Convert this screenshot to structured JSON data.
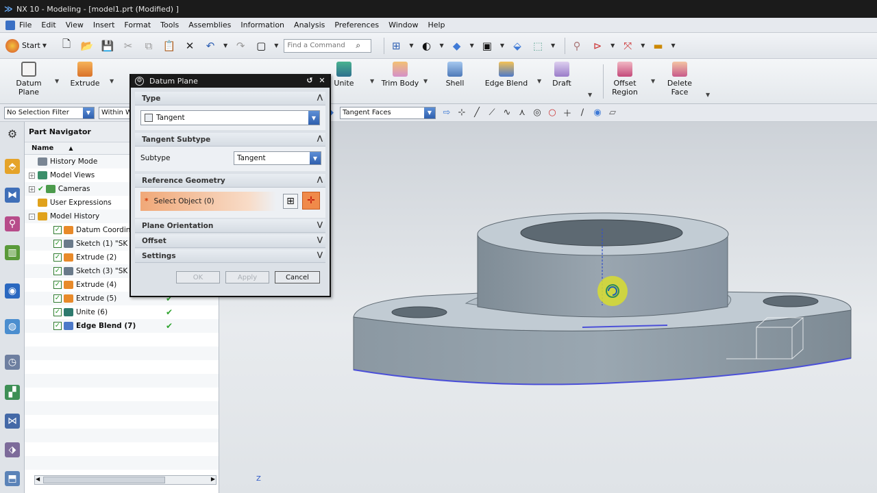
{
  "window": {
    "title": "NX 10 - Modeling - [model1.prt (Modified) ]"
  },
  "menu": [
    "File",
    "Edit",
    "View",
    "Insert",
    "Format",
    "Tools",
    "Assemblies",
    "Information",
    "Analysis",
    "Preferences",
    "Window",
    "Help"
  ],
  "toolbar": {
    "start_label": "Start",
    "search_placeholder": "Find a Command"
  },
  "ribbon": {
    "items": [
      {
        "label": "Datum Plane"
      },
      {
        "label": "Extrude"
      },
      {
        "label": "Unite"
      },
      {
        "label": "Trim Body"
      },
      {
        "label": "Shell"
      },
      {
        "label": "Edge Blend"
      },
      {
        "label": "Draft"
      },
      {
        "label": "Offset Region"
      },
      {
        "label": "Delete Face"
      }
    ]
  },
  "selection_bar": {
    "filter": "No Selection Filter",
    "scope": "Within W",
    "face_rule": "Tangent Faces"
  },
  "navigator": {
    "title": "Part Navigator",
    "column_name": "Name",
    "rows": [
      {
        "label": "History Mode",
        "level": 1,
        "expander": "",
        "check": false,
        "tick": false,
        "bold": false
      },
      {
        "label": "Model Views",
        "level": 1,
        "expander": "+",
        "check": false,
        "tick": false,
        "bold": false
      },
      {
        "label": "Cameras",
        "level": 1,
        "expander": "+",
        "check": false,
        "tick": false,
        "bold": false
      },
      {
        "label": "User Expressions",
        "level": 1,
        "expander": "",
        "check": false,
        "tick": false,
        "bold": false
      },
      {
        "label": "Model History",
        "level": 1,
        "expander": "-",
        "check": false,
        "tick": false,
        "bold": false
      },
      {
        "label": "Datum Coordin",
        "level": 2,
        "expander": "",
        "check": true,
        "tick": false,
        "bold": false
      },
      {
        "label": "Sketch (1) \"SK",
        "level": 2,
        "expander": "",
        "check": true,
        "tick": false,
        "bold": false
      },
      {
        "label": "Extrude (2)",
        "level": 2,
        "expander": "",
        "check": true,
        "tick": false,
        "bold": false
      },
      {
        "label": "Sketch (3) \"SK",
        "level": 2,
        "expander": "",
        "check": true,
        "tick": false,
        "bold": false
      },
      {
        "label": "Extrude (4)",
        "level": 2,
        "expander": "",
        "check": true,
        "tick": false,
        "bold": false
      },
      {
        "label": "Extrude (5)",
        "level": 2,
        "expander": "",
        "check": true,
        "tick": true,
        "bold": false
      },
      {
        "label": "Unite (6)",
        "level": 2,
        "expander": "",
        "check": true,
        "tick": true,
        "bold": false
      },
      {
        "label": "Edge Blend (7)",
        "level": 2,
        "expander": "",
        "check": true,
        "tick": true,
        "bold": true
      }
    ]
  },
  "dialog": {
    "title": "Datum Plane",
    "type_header": "Type",
    "type_value": "Tangent",
    "subtype_header": "Tangent Subtype",
    "subtype_label": "Subtype",
    "subtype_value": "Tangent",
    "ref_header": "Reference Geometry",
    "select_object": "Select Object (0)",
    "orientation_header": "Plane Orientation",
    "offset_header": "Offset",
    "settings_header": "Settings",
    "ok": "OK",
    "apply": "Apply",
    "cancel": "Cancel"
  },
  "colors": {
    "accent": "#2f5fae",
    "highlight": "#f0a878",
    "part": "#8e9ca6",
    "title_bar": "#1b1b1b"
  }
}
